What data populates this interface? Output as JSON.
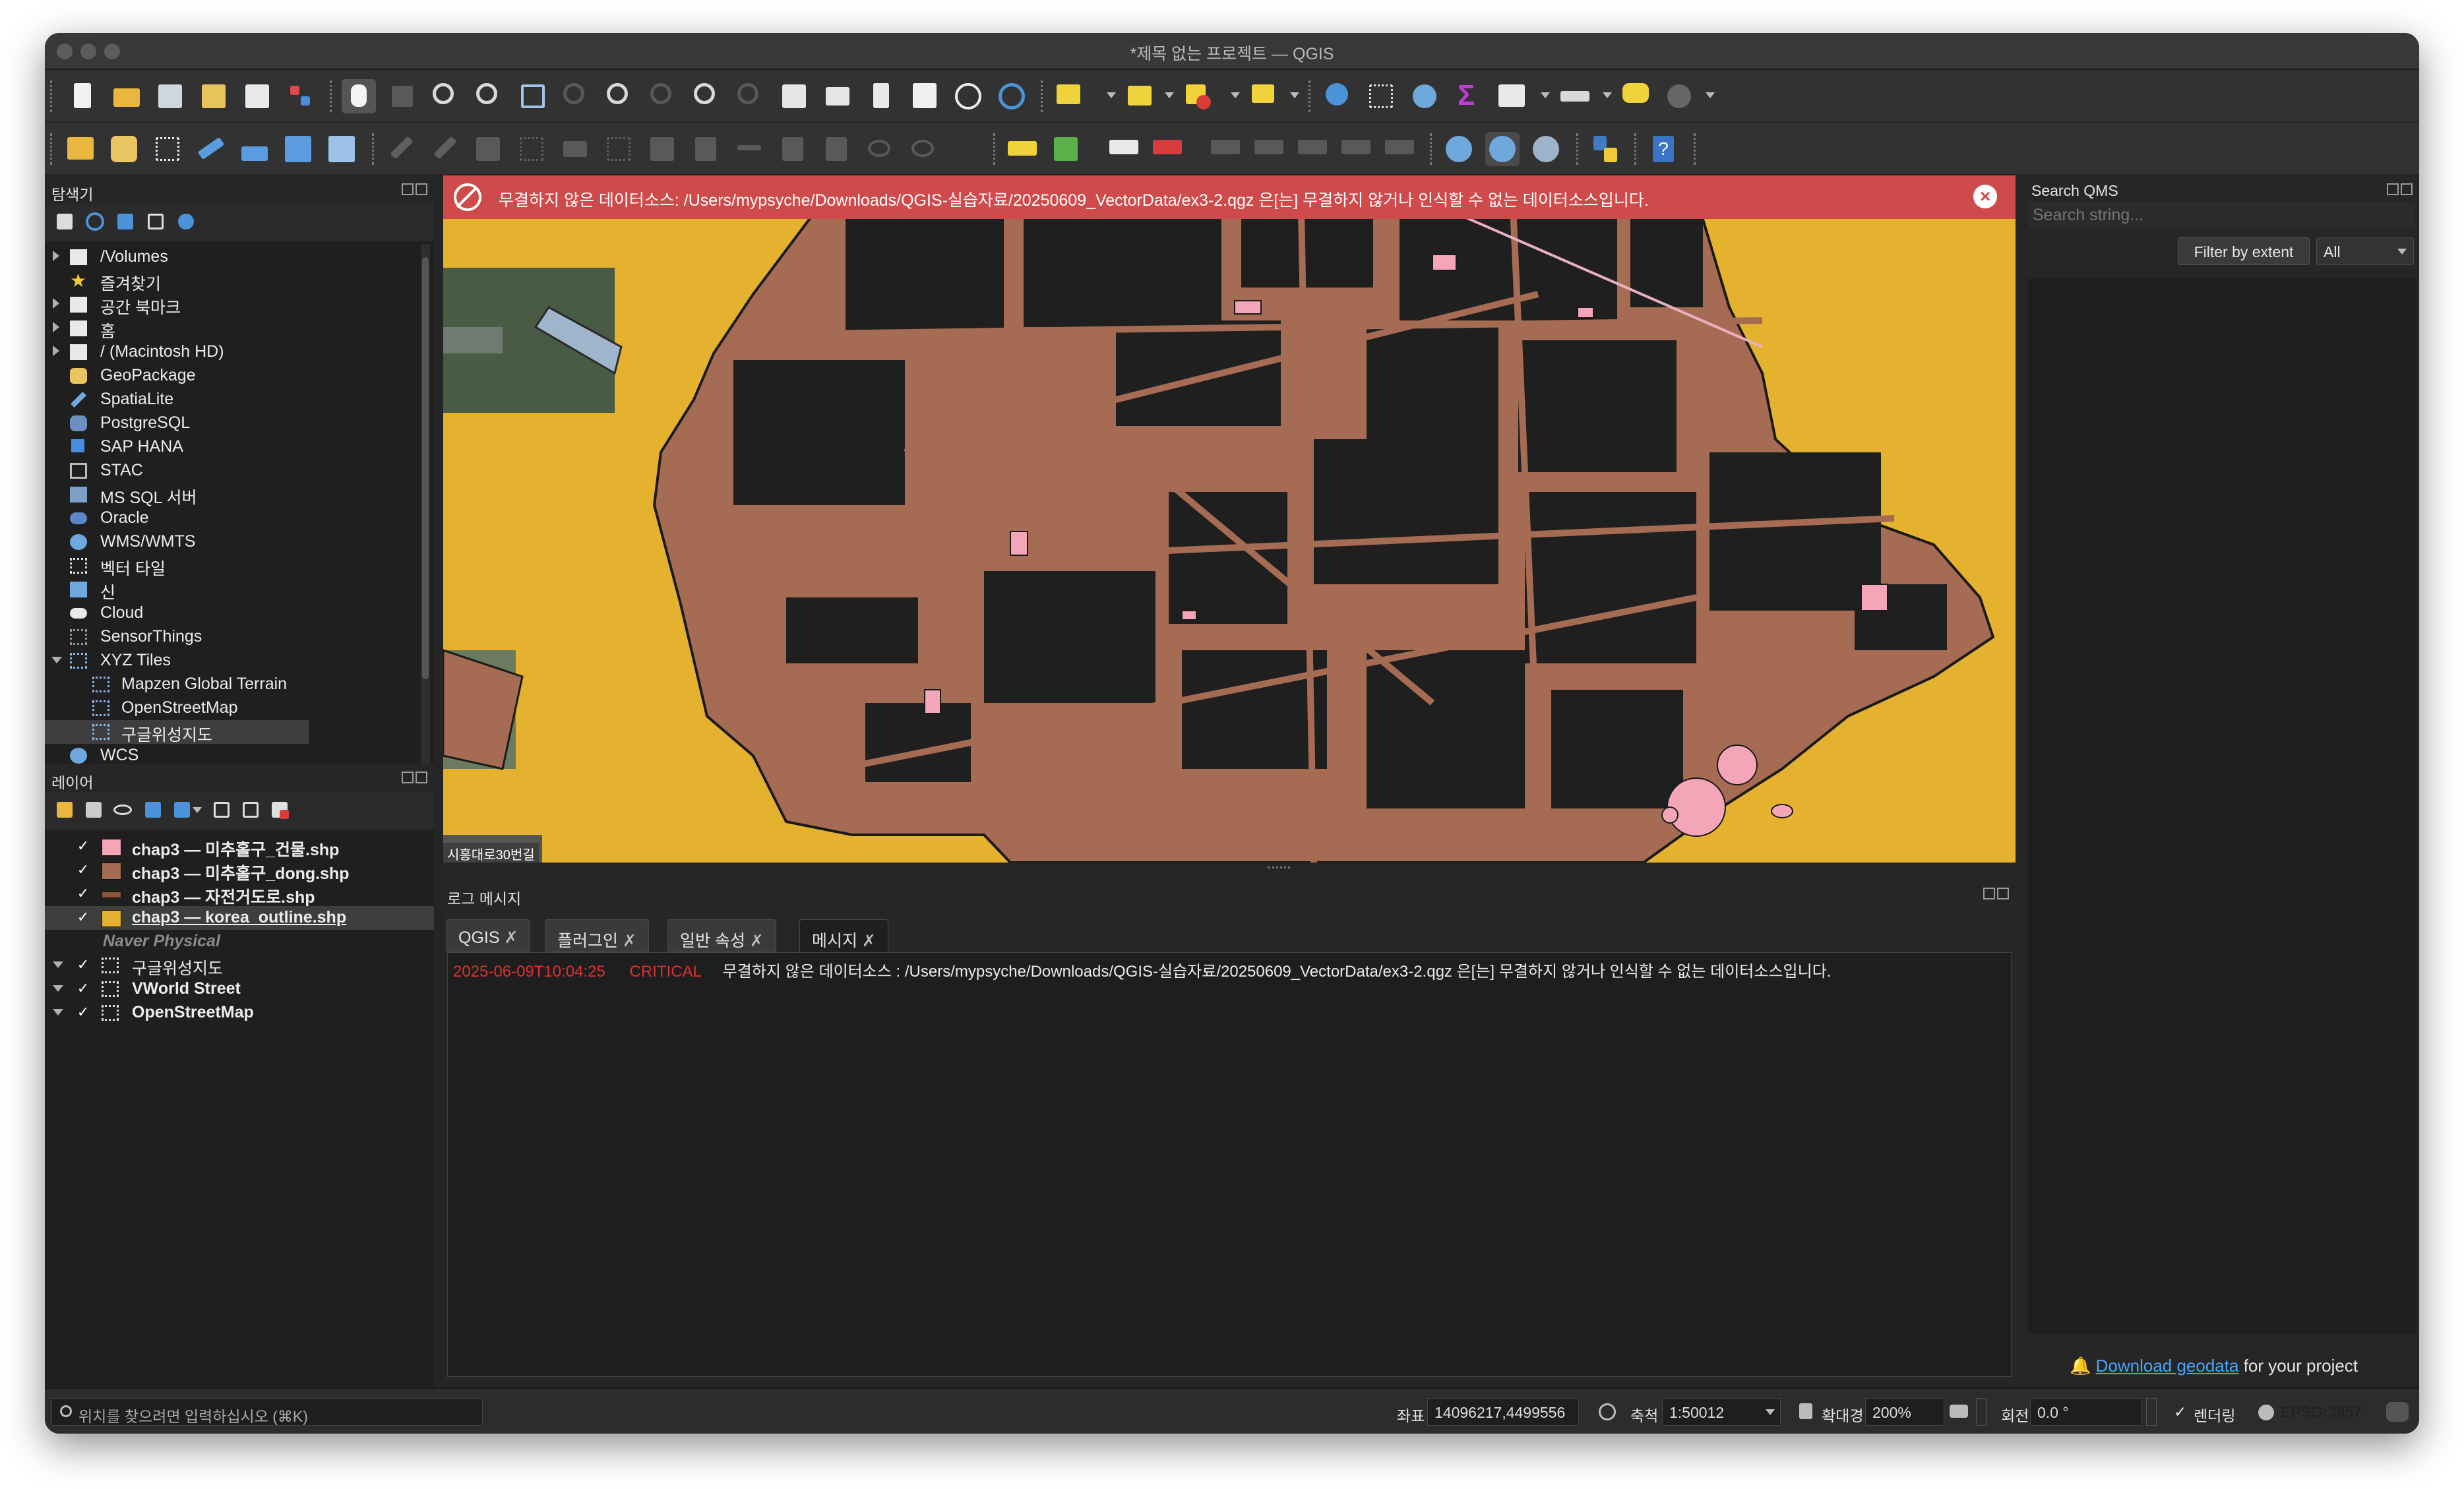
{
  "window": {
    "title": "*제목 없는 프로젝트 — QGIS"
  },
  "browser": {
    "title": "탐색기",
    "items": [
      {
        "label": "/Volumes",
        "icon": "folder-icon"
      },
      {
        "label": "즐겨찾기",
        "icon": "star-icon"
      },
      {
        "label": "공간 북마크",
        "icon": "bookmark-icon"
      },
      {
        "label": "홈",
        "icon": "home-folder-icon"
      },
      {
        "label": "/ (Macintosh HD)",
        "icon": "folder-icon"
      },
      {
        "label": "GeoPackage",
        "icon": "geopackage-icon"
      },
      {
        "label": "SpatiaLite",
        "icon": "spatialite-icon"
      },
      {
        "label": "PostgreSQL",
        "icon": "postgresql-icon"
      },
      {
        "label": "SAP HANA",
        "icon": "sap-hana-icon"
      },
      {
        "label": "STAC",
        "icon": "stac-icon"
      },
      {
        "label": "MS SQL 서버",
        "icon": "mssql-icon"
      },
      {
        "label": "Oracle",
        "icon": "oracle-icon"
      },
      {
        "label": "WMS/WMTS",
        "icon": "globe-icon"
      },
      {
        "label": "벡터 타일",
        "icon": "vector-tile-icon"
      },
      {
        "label": "신",
        "icon": "scene-icon"
      },
      {
        "label": "Cloud",
        "icon": "cloud-icon"
      },
      {
        "label": "SensorThings",
        "icon": "sensorthings-icon"
      },
      {
        "label": "XYZ Tiles",
        "icon": "xyz-tiles-icon"
      },
      {
        "label": "Mapzen Global Terrain",
        "icon": "xyz-tiles-icon"
      },
      {
        "label": "OpenStreetMap",
        "icon": "xyz-tiles-icon"
      },
      {
        "label": "구글위성지도",
        "icon": "xyz-tiles-icon"
      },
      {
        "label": "WCS",
        "icon": "globe-icon"
      }
    ]
  },
  "layers": {
    "title": "레이어",
    "items": [
      {
        "label": "chap3 — 미추홀구_건물.shp",
        "checked": "✓",
        "color": "#f4a6b8"
      },
      {
        "label": "chap3 — 미추홀구_dong.shp",
        "checked": "✓",
        "color": "#a66b53"
      },
      {
        "label": "chap3 — 자전거도로.shp",
        "checked": "✓",
        "color": "#8a5538"
      },
      {
        "label": "chap3 — korea_outline.shp",
        "checked": "✓",
        "color": "#e5b22f"
      },
      {
        "label": "Naver Physical"
      },
      {
        "label": "구글위성지도",
        "checked": "✓"
      },
      {
        "label": "VWorld Street",
        "checked": "✓"
      },
      {
        "label": "OpenStreetMap",
        "checked": "✓"
      }
    ]
  },
  "banner": {
    "message": "무결하지 않은 데이터소스: /Users/mypsyche/Downloads/QGIS-실습자료/20250609_VectorData/ex3-2.qgz 은[는] 무결하지 않거나 인식할 수 없는 데이터소스입니다."
  },
  "map": {
    "corner_label": "시흥대로30번길",
    "colors": {
      "background": "#e5b22f",
      "district": "#a66b53",
      "buildings": "#1e1e1e",
      "highlight": "#f4a6b8"
    }
  },
  "log": {
    "title": "로그 메시지",
    "tabs": [
      "QGIS",
      "플러그인",
      "일반 속성",
      "메시지"
    ],
    "active_tab": "메시지",
    "entry": {
      "timestamp": "2025-06-09T10:04:25",
      "level": "CRITICAL",
      "text": "무결하지 않은 데이터소스 : /Users/mypsyche/Downloads/QGIS-실습자료/20250609_VectorData/ex3-2.qgz 은[는] 무결하지 않거나 인식할 수 없는 데이터소스입니다."
    }
  },
  "qms": {
    "title": "Search QMS",
    "search_placeholder": "Search string...",
    "filter_button": "Filter by extent",
    "filter_select": "All",
    "footer_link": "Download geodata",
    "footer_text": "for your project"
  },
  "status": {
    "search_placeholder": "위치를 찾으려면 입력하십시오 (⌘K)",
    "coord_label": "좌표",
    "coord_value": "14096217,4499556",
    "scale_label": "축척",
    "scale_value": "1:50012",
    "magnifier_label": "확대경",
    "magnifier_value": "200%",
    "rotation_label": "회전",
    "rotation_value": "0.0 °",
    "render_check": "✓",
    "render_label": "렌더링",
    "crs": "EPSG:3857"
  }
}
